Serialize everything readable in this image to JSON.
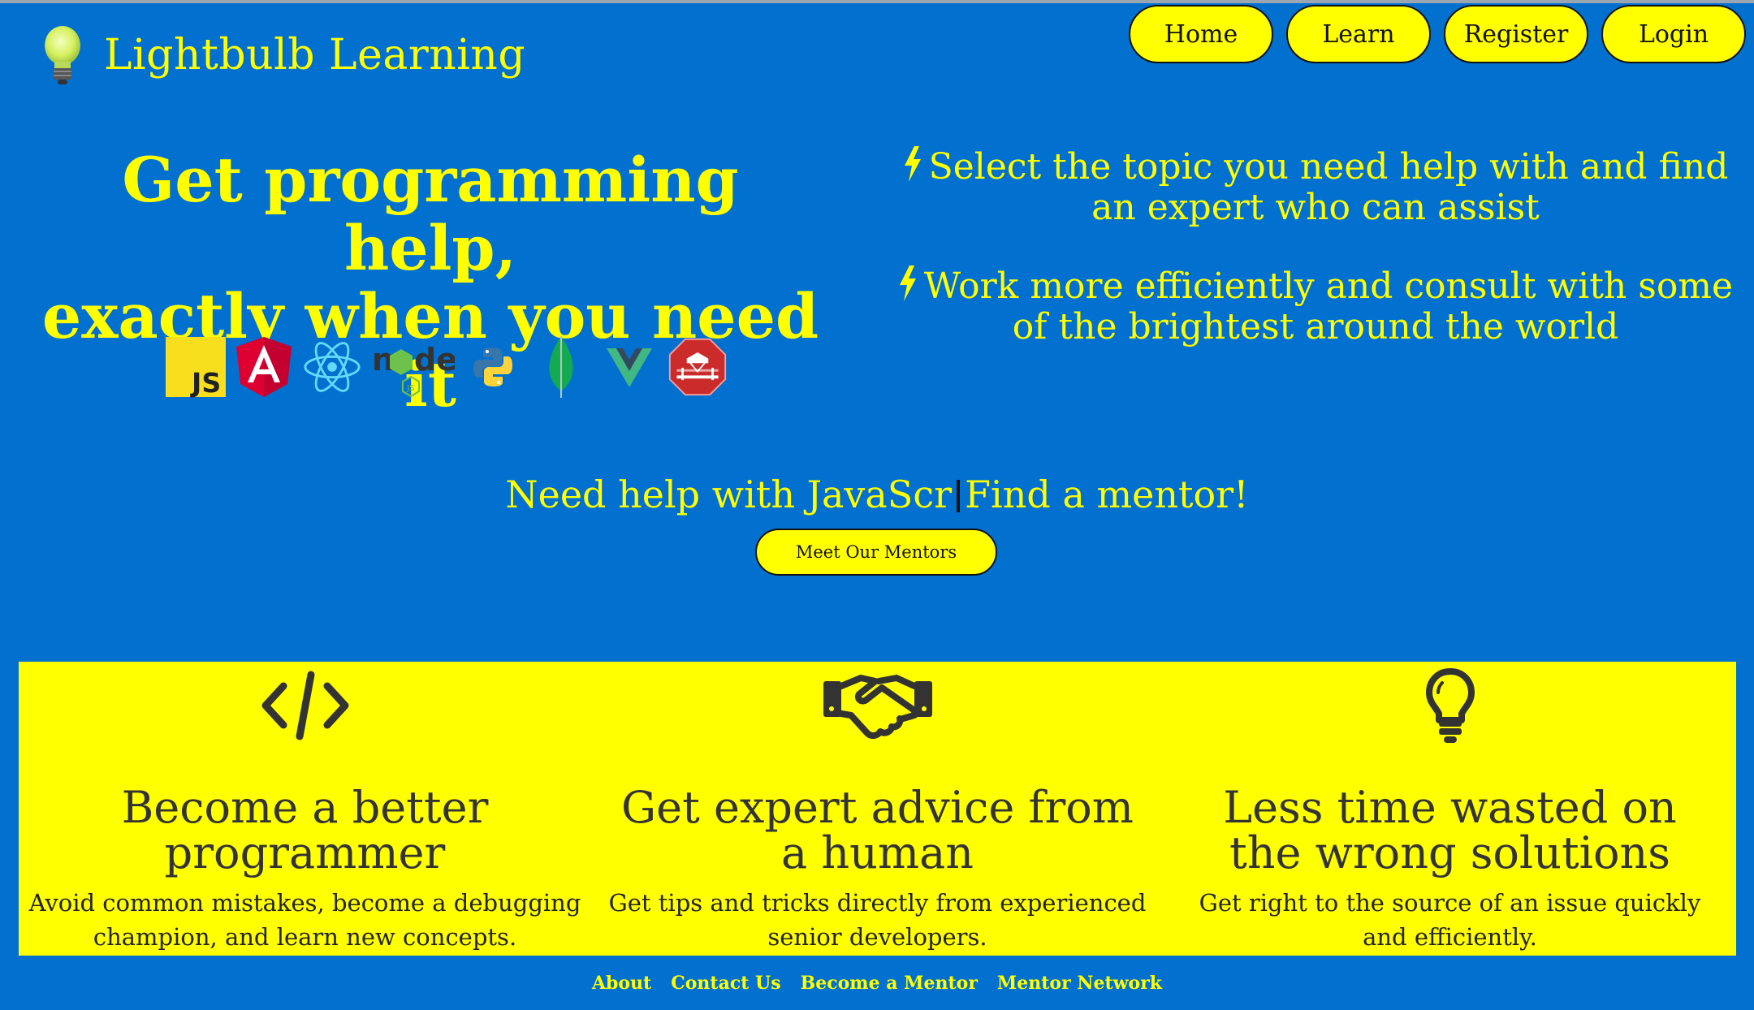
{
  "brand": {
    "title": "Lightbulb Learning",
    "logo_icon": "lightbulb-icon"
  },
  "nav": {
    "items": [
      {
        "label": "Home"
      },
      {
        "label": "Learn"
      },
      {
        "label": "Register"
      },
      {
        "label": "Login"
      }
    ]
  },
  "hero": {
    "heading_line1": "Get programming help,",
    "heading_line2": "exactly when you need it",
    "technologies": [
      {
        "name": "javascript-logo-icon",
        "label": "JS"
      },
      {
        "name": "angular-logo-icon",
        "label": "A"
      },
      {
        "name": "react-logo-icon"
      },
      {
        "name": "nodejs-logo-icon"
      },
      {
        "name": "python-logo-icon"
      },
      {
        "name": "mongodb-logo-icon"
      },
      {
        "name": "vue-logo-icon"
      },
      {
        "name": "ruby-on-rails-logo-icon"
      }
    ]
  },
  "features": [
    {
      "icon": "bolt-icon",
      "text": "Select the topic you need help with and find an expert who can assist"
    },
    {
      "icon": "bolt-icon",
      "text": "Work more efficiently and consult with some of the brightest around the world"
    }
  ],
  "typing": {
    "prefix": "Need help with JavaScr",
    "suffix": "Find a mentor!"
  },
  "cta": {
    "label": "Meet Our Mentors"
  },
  "benefits": [
    {
      "icon": "code-icon",
      "title": "Become a better programmer",
      "text": "Avoid common mistakes, become a debugging champion, and learn new concepts."
    },
    {
      "icon": "handshake-icon",
      "title": "Get expert advice from a human",
      "text": "Get tips and tricks directly from experienced senior developers."
    },
    {
      "icon": "lightbulb-outline-icon",
      "title": "Less time wasted on the wrong solutions",
      "text": "Get right to the source of an issue quickly and efficiently."
    }
  ],
  "footer": {
    "links": [
      {
        "label": "About"
      },
      {
        "label": "Contact Us"
      },
      {
        "label": "Become a Mentor"
      },
      {
        "label": "Mentor Network"
      }
    ]
  },
  "colors": {
    "background": "#0270ce",
    "accent": "#ffff00",
    "dark": "#333333"
  }
}
